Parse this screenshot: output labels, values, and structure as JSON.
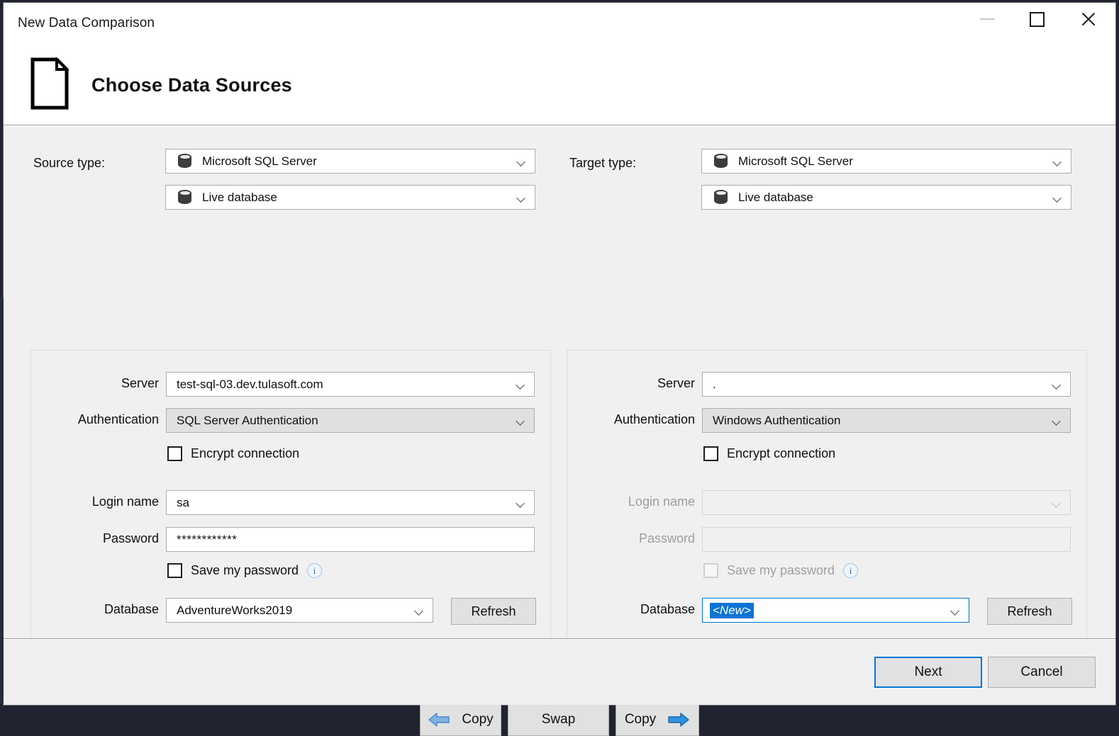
{
  "window": {
    "title": "New Data Comparison",
    "minimize_label": "Minimize",
    "maximize_label": "Maximize",
    "close_label": "Close"
  },
  "header": {
    "title": "Choose Data Sources",
    "icon": "document-icon"
  },
  "source": {
    "type_label": "Source type:",
    "provider": "Microsoft SQL Server",
    "mode": "Live database",
    "server_label": "Server",
    "server_value": "test-sql-03.dev.tulasoft.com",
    "auth_label": "Authentication",
    "auth_value": "SQL Server Authentication",
    "encrypt_label": "Encrypt connection",
    "encrypt_checked": false,
    "login_label": "Login name",
    "login_value": "sa",
    "password_label": "Password",
    "password_value": "************",
    "save_password_label": "Save my password",
    "save_password_checked": false,
    "info_glyph": "i",
    "database_label": "Database",
    "database_value": "AdventureWorks2019",
    "refresh_label": "Refresh"
  },
  "target": {
    "type_label": "Target type:",
    "provider": "Microsoft SQL Server",
    "mode": "Live database",
    "server_label": "Server",
    "server_value": ".",
    "auth_label": "Authentication",
    "auth_value": "Windows Authentication",
    "encrypt_label": "Encrypt connection",
    "encrypt_checked": false,
    "login_label": "Login name",
    "login_value": "",
    "password_label": "Password",
    "password_value": "",
    "save_password_label": "Save my password",
    "save_password_checked": false,
    "info_glyph": "i",
    "database_label": "Database",
    "database_value": "<New>",
    "refresh_label": "Refresh"
  },
  "actions": {
    "copy_left_label": "Copy",
    "swap_label": "Swap",
    "copy_right_label": "Copy"
  },
  "footer": {
    "next_label": "Next",
    "cancel_label": "Cancel"
  },
  "colors": {
    "accent": "#0078d7",
    "selection": "#0b74d4",
    "arrow_left": "#6fa8dc",
    "arrow_right": "#1e8bd6",
    "window_bg": "#f0f0f0",
    "header_bg": "#ffffff"
  }
}
